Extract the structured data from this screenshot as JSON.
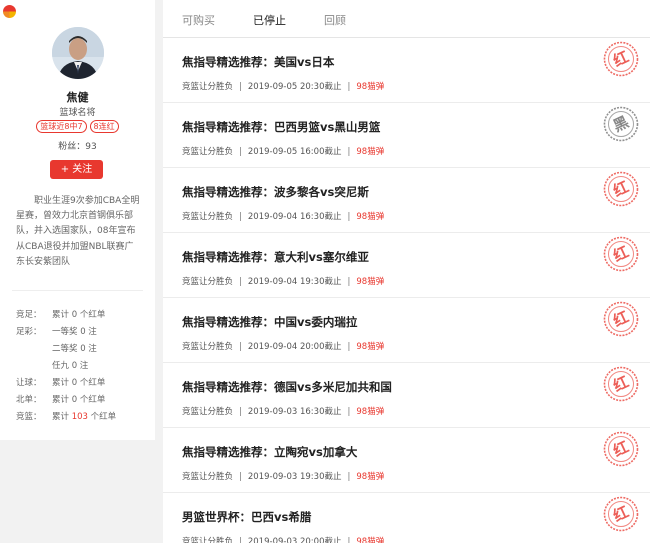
{
  "brand": {
    "logo_icon": "lottery-logo-icon"
  },
  "profile": {
    "name": "焦健",
    "role": "篮球名将",
    "badges": [
      "篮球近8中7",
      "8连红"
    ],
    "fans": "粉丝：93",
    "follow_label": "+ 关注",
    "bio": "职业生涯9次参加CBA全明星赛，曾效力北京首钢俱乐部队，并入选国家队，08年宣布从CBA退役并加盟NBL联赛广东长安紫团队",
    "stats": [
      {
        "label": "竞足：",
        "value_pre": "累计 ",
        "value_num": "0",
        "value_post": " 个红单"
      },
      {
        "label": "足彩：",
        "value_pre": "一等奖 0 注",
        "value_num": "",
        "value_post": ""
      },
      {
        "label": "",
        "value_pre": "二等奖 0 注",
        "value_num": "",
        "value_post": ""
      },
      {
        "label": "",
        "value_pre": "任九 0 注",
        "value_num": "",
        "value_post": ""
      },
      {
        "label": "让球：",
        "value_pre": "累计 ",
        "value_num": "0",
        "value_post": " 个红单"
      },
      {
        "label": "北单：",
        "value_pre": "累计 ",
        "value_num": "0",
        "value_post": " 个红单"
      },
      {
        "label": "竞篮：",
        "value_pre": "累计 ",
        "value_num": "103",
        "value_post": " 个红单"
      }
    ]
  },
  "tabs": [
    {
      "label": "可购买",
      "active": false
    },
    {
      "label": "已停止",
      "active": true
    },
    {
      "label": "回顾",
      "active": false
    }
  ],
  "items": [
    {
      "title": "焦指导精选推荐：美国vs日本",
      "play": "竞篮让分胜负",
      "time": "2019-09-05 20:30截止",
      "price": "98猫弹",
      "result": "红"
    },
    {
      "title": "焦指导精选推荐：巴西男篮vs黑山男篮",
      "play": "竞篮让分胜负",
      "time": "2019-09-05 16:00截止",
      "price": "98猫弹",
      "result": "黑"
    },
    {
      "title": "焦指导精选推荐：波多黎各vs突尼斯",
      "play": "竞篮让分胜负",
      "time": "2019-09-04 16:30截止",
      "price": "98猫弹",
      "result": "红"
    },
    {
      "title": "焦指导精选推荐：意大利vs塞尔维亚",
      "play": "竞篮让分胜负",
      "time": "2019-09-04 19:30截止",
      "price": "98猫弹",
      "result": "红"
    },
    {
      "title": "焦指导精选推荐：中国vs委内瑞拉",
      "play": "竞篮让分胜负",
      "time": "2019-09-04 20:00截止",
      "price": "98猫弹",
      "result": "红"
    },
    {
      "title": "焦指导精选推荐：德国vs多米尼加共和国",
      "play": "竞篮让分胜负",
      "time": "2019-09-03 16:30截止",
      "price": "98猫弹",
      "result": "红"
    },
    {
      "title": "焦指导精选推荐：立陶宛vs加拿大",
      "play": "竞篮让分胜负",
      "time": "2019-09-03 19:30截止",
      "price": "98猫弹",
      "result": "红"
    },
    {
      "title": "男篮世界杯：巴西vs希腊",
      "play": "竞篮让分胜负",
      "time": "2019-09-03 20:00截止",
      "price": "98猫弹",
      "result": "红"
    }
  ],
  "colors": {
    "accent": "#e8382f",
    "stamp_red": "#e8382f",
    "stamp_black": "#6b6b6b"
  }
}
